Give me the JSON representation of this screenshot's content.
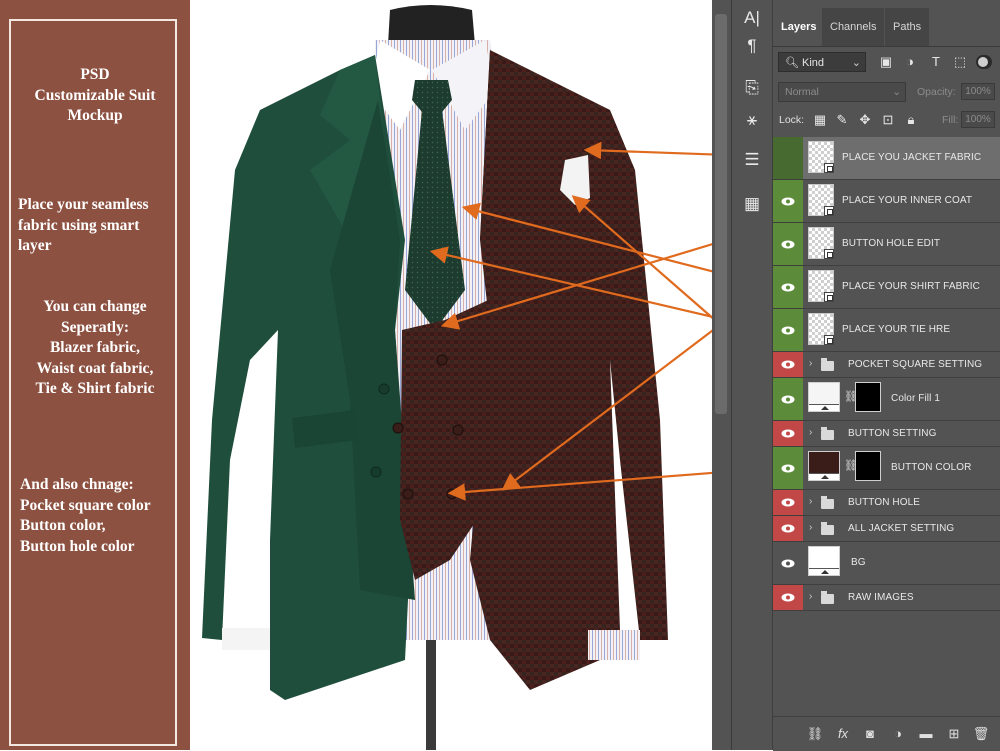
{
  "promo": {
    "title_lines": [
      "PSD",
      "Customizable Suit",
      "Mockup"
    ],
    "p1_lines": [
      "Place your seamless",
      "fabric using smart",
      "layer"
    ],
    "p2_lines": [
      "You can change",
      "Seperatly:",
      "Blazer fabric,",
      "Waist coat fabric,",
      "Tie & Shirt fabric"
    ],
    "p3_lines": [
      "And also chnage:",
      "Pocket square color",
      "Button color,",
      "Button hole color"
    ]
  },
  "toolstrip": {
    "icons": [
      "character-icon",
      "paragraph-icon",
      "adjust-icon",
      "styles-icon",
      "properties-icon",
      "table-icon"
    ]
  },
  "panel": {
    "tabs": [
      {
        "label": "Layers",
        "active": true
      },
      {
        "label": "Channels",
        "active": false
      },
      {
        "label": "Paths",
        "active": false
      }
    ],
    "kind_label": "Kind",
    "blend_mode": "Normal",
    "opacity_label": "Opacity:",
    "opacity_value": "100%",
    "lock_label": "Lock:",
    "fill_label": "Fill:",
    "fill_value": "100%",
    "layers": [
      {
        "name": "PLACE YOU JACKET FABRIC",
        "type": "smart",
        "eye": "none",
        "selected": true
      },
      {
        "name": "PLACE YOUR INNER COAT",
        "type": "smart",
        "eye": "green"
      },
      {
        "name": "BUTTON HOLE EDIT",
        "type": "smart",
        "eye": "green"
      },
      {
        "name": "PLACE YOUR SHIRT FABRIC",
        "type": "smart",
        "eye": "green"
      },
      {
        "name": "PLACE YOUR TIE HRE",
        "type": "smart",
        "eye": "green"
      },
      {
        "name": "POCKET SQUARE SETTING",
        "type": "group",
        "eye": "red"
      },
      {
        "name": "Color Fill 1",
        "type": "fill",
        "eye": "green",
        "fill_color": "#f5f5f5"
      },
      {
        "name": "BUTTON SETTING",
        "type": "group",
        "eye": "red"
      },
      {
        "name": "BUTTON COLOR",
        "type": "fill",
        "eye": "green",
        "fill_color": "#3a1c18"
      },
      {
        "name": "BUTTON HOLE",
        "type": "group",
        "eye": "red"
      },
      {
        "name": "ALL JACKET SETTING",
        "type": "group",
        "eye": "red"
      },
      {
        "name": "BG",
        "type": "plain",
        "eye": "plain"
      },
      {
        "name": "RAW IMAGES",
        "type": "group",
        "eye": "red"
      }
    ]
  },
  "colors": {
    "promo_bg": "#8c5141",
    "panel_bg": "#535353",
    "eye_green": "#5c8c3a",
    "eye_red": "#c24848",
    "arrow": "#e06a1e",
    "jacket_green": "#1f4f3c",
    "plaid_base": "#4a1f1c"
  }
}
